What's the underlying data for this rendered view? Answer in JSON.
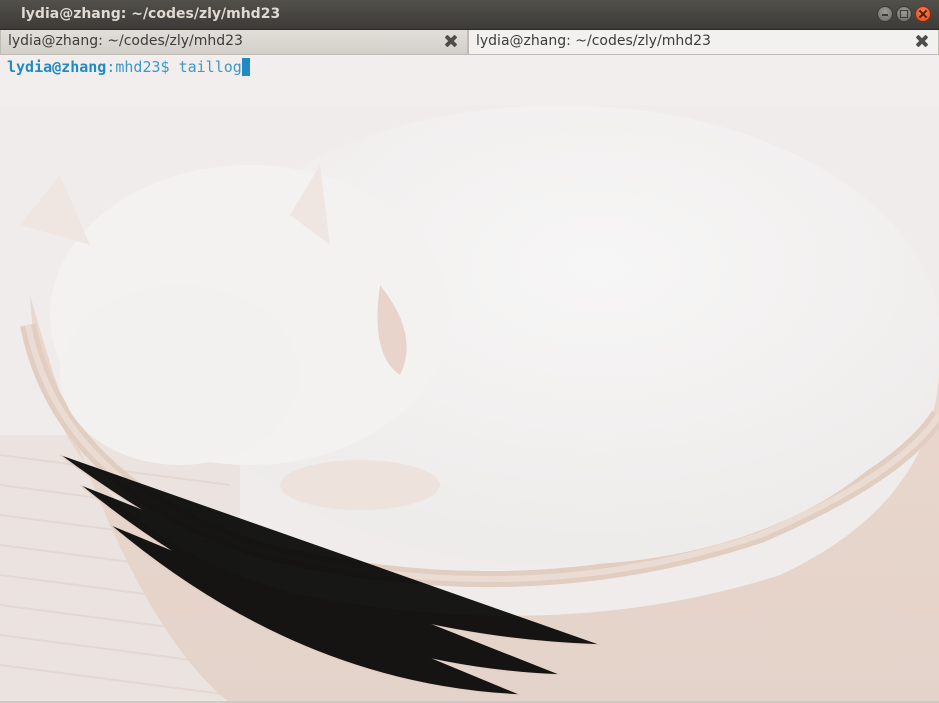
{
  "window": {
    "title": "lydia@zhang: ~/codes/zly/mhd23"
  },
  "tabs": [
    {
      "label": "lydia@zhang: ~/codes/zly/mhd23",
      "state": "inactive",
      "close_icon": "close-icon"
    },
    {
      "label": "lydia@zhang: ~/codes/zly/mhd23",
      "state": "active",
      "close_icon": "close-icon"
    }
  ],
  "terminal": {
    "prompt_user": "lydia@zhang",
    "prompt_colon": ":",
    "prompt_dir": "mhd23",
    "prompt_symbol": "$ ",
    "command": "taillog",
    "colors": {
      "user": "#1e8cc2",
      "text": "#3d98c8",
      "cursor": "#1f8ac4"
    }
  },
  "colors": {
    "titlebar": "#3c3b37",
    "close_button": "#df4a16",
    "tab_active": "#f2f1ef",
    "tab_inactive": "#d2cec8"
  }
}
